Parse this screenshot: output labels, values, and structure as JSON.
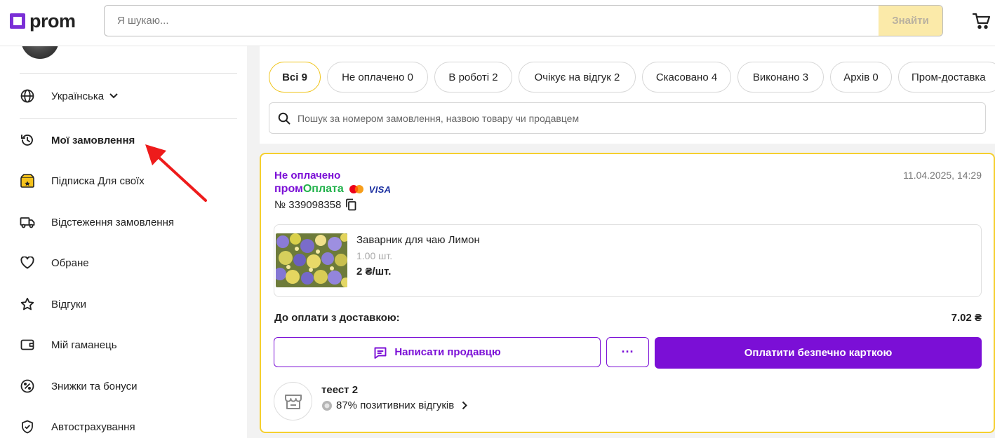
{
  "header": {
    "logo_text": "prom",
    "search_placeholder": "Я шукаю...",
    "search_button": "Знайти",
    "cart_icon": "cart-icon",
    "brand_color": "#7a2fd6"
  },
  "sidebar": {
    "language": "Українська",
    "items": [
      {
        "label": "Мої замовлення",
        "icon": "history-icon",
        "active": true
      },
      {
        "label": "Підписка Для своїх",
        "icon": "subscription-box-icon"
      },
      {
        "label": "Відстеження замовлення",
        "icon": "truck-icon"
      },
      {
        "label": "Обране",
        "icon": "heart-icon"
      },
      {
        "label": "Відгуки",
        "icon": "star-icon"
      },
      {
        "label": "Мій гаманець",
        "icon": "wallet-icon"
      },
      {
        "label": "Знижки та бонуси",
        "icon": "discount-icon"
      },
      {
        "label": "Автострахування",
        "icon": "shield-icon"
      }
    ]
  },
  "filters": {
    "chips": [
      "Всі 9",
      "Не оплачено 0",
      "В роботі 2",
      "Очікує на відгук 2",
      "Скасовано 4",
      "Виконано 3",
      "Архів 0",
      "Пром-доставка"
    ],
    "active_index": 0,
    "order_search_placeholder": "Пошук за номером замовлення, назвою товару чи продавцем"
  },
  "order": {
    "status": "Не оплачено",
    "payment_brand_a": "пром",
    "payment_brand_b": "Оплата",
    "visa": "VISA",
    "number": "№ 339098358",
    "date": "11.04.2025, 14:29",
    "product": {
      "name": "Заварник для чаю Лимон",
      "qty": "1.00 шт.",
      "price": "2 ₴/шт."
    },
    "total_label": "До оплати з доставкою:",
    "total_value": "7.02 ₴",
    "write_seller": "Написати продавцю",
    "more": "···",
    "pay_button": "Оплатити безпечно карткою",
    "seller": {
      "name": "теест 2",
      "rating": "87% позитивних відгуків"
    },
    "accent_color": "#7b0fd6",
    "card_border_color": "#f5cf2e"
  }
}
